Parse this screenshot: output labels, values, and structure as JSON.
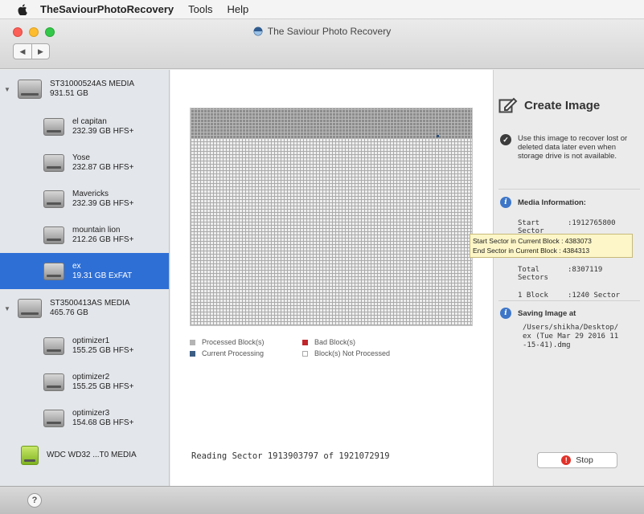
{
  "menubar": {
    "app_name": "TheSaviourPhotoRecovery",
    "items": [
      "Tools",
      "Help"
    ]
  },
  "window": {
    "title": "The Saviour Photo Recovery"
  },
  "sidebar": {
    "drives": [
      {
        "name": "ST31000524AS MEDIA",
        "size": "931.51 GB",
        "type": "parent"
      },
      {
        "name": "el capitan",
        "size": "232.39 GB HFS+",
        "type": "child"
      },
      {
        "name": "Yose",
        "size": "232.87 GB HFS+",
        "type": "child"
      },
      {
        "name": "Mavericks",
        "size": "232.39 GB HFS+",
        "type": "child"
      },
      {
        "name": "mountain lion",
        "size": "212.26 GB HFS+",
        "type": "child"
      },
      {
        "name": "ex",
        "size": "19.31 GB ExFAT",
        "type": "child",
        "selected": true
      },
      {
        "name": "ST3500413AS MEDIA",
        "size": "465.76 GB",
        "type": "parent"
      },
      {
        "name": "optimizer1",
        "size": "155.25 GB HFS+",
        "type": "child"
      },
      {
        "name": "optimizer2",
        "size": "155.25 GB HFS+",
        "type": "child"
      },
      {
        "name": "optimizer3",
        "size": "154.68 GB HFS+",
        "type": "child"
      },
      {
        "name": "WDC WD32 ...T0 MEDIA",
        "size": "",
        "type": "usb"
      }
    ]
  },
  "main": {
    "legend": {
      "processed": "Processed Block(s)",
      "bad": "Bad Block(s)",
      "current": "Current Processing",
      "not_processed": "Block(s) Not Processed"
    },
    "reading_label": "Reading Sector",
    "reading_current": "1913903797",
    "reading_of": "of",
    "reading_total": "1921072919"
  },
  "right": {
    "create_title": "Create Image",
    "description": "Use this image to recover lost or deleted data later even when storage drive is not available.",
    "media_info_title": "Media Information:",
    "start_sector_label": "Start Sector",
    "start_sector_value": ":1912765800",
    "total_sectors_label": "Total Sectors",
    "total_sectors_value": ":8307119",
    "block_label": "1 Block",
    "block_value": ":1240 Sector",
    "saving_title": "Saving Image at",
    "saving_path": "/Users/shikha/Desktop/ex (Tue Mar 29 2016 11-15-41).dmg",
    "stop_label": "Stop"
  },
  "tooltip": {
    "line1": "Start Sector in Current Block : 4383073",
    "line2": "End Sector in Current Block : 4384313"
  },
  "footer": {
    "help_label": "?"
  },
  "colors": {
    "selection": "#2e6fd6",
    "bad_block": "#c0262b",
    "current_block": "#3c5d84",
    "stop": "#e0322a"
  }
}
